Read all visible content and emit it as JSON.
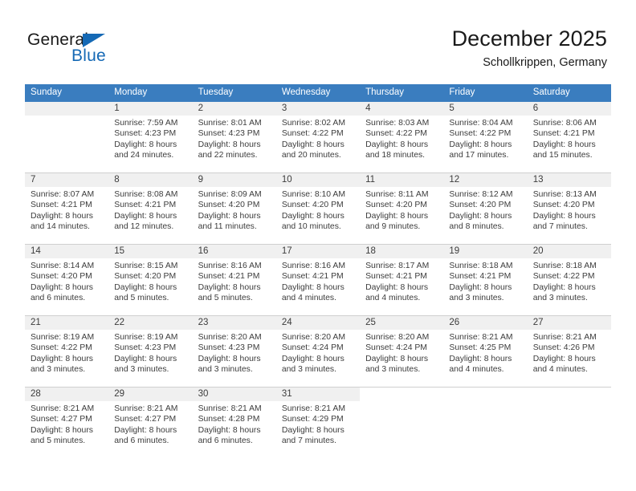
{
  "brand": {
    "name_part1": "General",
    "name_part2": "Blue",
    "triangle_icon": "triangle-icon",
    "color_primary": "#1569b5",
    "color_text": "#1a1a1a"
  },
  "header": {
    "title": "December 2025",
    "subtitle": "Schollkrippen, Germany",
    "header_bg": "#3a7dbf",
    "header_text_color": "#ffffff"
  },
  "weekdays": [
    "Sunday",
    "Monday",
    "Tuesday",
    "Wednesday",
    "Thursday",
    "Friday",
    "Saturday"
  ],
  "weeks": [
    [
      {
        "day": "",
        "empty": true
      },
      {
        "day": "1",
        "sunrise": "Sunrise: 7:59 AM",
        "sunset": "Sunset: 4:23 PM",
        "daylight1": "Daylight: 8 hours",
        "daylight2": "and 24 minutes."
      },
      {
        "day": "2",
        "sunrise": "Sunrise: 8:01 AM",
        "sunset": "Sunset: 4:23 PM",
        "daylight1": "Daylight: 8 hours",
        "daylight2": "and 22 minutes."
      },
      {
        "day": "3",
        "sunrise": "Sunrise: 8:02 AM",
        "sunset": "Sunset: 4:22 PM",
        "daylight1": "Daylight: 8 hours",
        "daylight2": "and 20 minutes."
      },
      {
        "day": "4",
        "sunrise": "Sunrise: 8:03 AM",
        "sunset": "Sunset: 4:22 PM",
        "daylight1": "Daylight: 8 hours",
        "daylight2": "and 18 minutes."
      },
      {
        "day": "5",
        "sunrise": "Sunrise: 8:04 AM",
        "sunset": "Sunset: 4:22 PM",
        "daylight1": "Daylight: 8 hours",
        "daylight2": "and 17 minutes."
      },
      {
        "day": "6",
        "sunrise": "Sunrise: 8:06 AM",
        "sunset": "Sunset: 4:21 PM",
        "daylight1": "Daylight: 8 hours",
        "daylight2": "and 15 minutes."
      }
    ],
    [
      {
        "day": "7",
        "sunrise": "Sunrise: 8:07 AM",
        "sunset": "Sunset: 4:21 PM",
        "daylight1": "Daylight: 8 hours",
        "daylight2": "and 14 minutes."
      },
      {
        "day": "8",
        "sunrise": "Sunrise: 8:08 AM",
        "sunset": "Sunset: 4:21 PM",
        "daylight1": "Daylight: 8 hours",
        "daylight2": "and 12 minutes."
      },
      {
        "day": "9",
        "sunrise": "Sunrise: 8:09 AM",
        "sunset": "Sunset: 4:20 PM",
        "daylight1": "Daylight: 8 hours",
        "daylight2": "and 11 minutes."
      },
      {
        "day": "10",
        "sunrise": "Sunrise: 8:10 AM",
        "sunset": "Sunset: 4:20 PM",
        "daylight1": "Daylight: 8 hours",
        "daylight2": "and 10 minutes."
      },
      {
        "day": "11",
        "sunrise": "Sunrise: 8:11 AM",
        "sunset": "Sunset: 4:20 PM",
        "daylight1": "Daylight: 8 hours",
        "daylight2": "and 9 minutes."
      },
      {
        "day": "12",
        "sunrise": "Sunrise: 8:12 AM",
        "sunset": "Sunset: 4:20 PM",
        "daylight1": "Daylight: 8 hours",
        "daylight2": "and 8 minutes."
      },
      {
        "day": "13",
        "sunrise": "Sunrise: 8:13 AM",
        "sunset": "Sunset: 4:20 PM",
        "daylight1": "Daylight: 8 hours",
        "daylight2": "and 7 minutes."
      }
    ],
    [
      {
        "day": "14",
        "sunrise": "Sunrise: 8:14 AM",
        "sunset": "Sunset: 4:20 PM",
        "daylight1": "Daylight: 8 hours",
        "daylight2": "and 6 minutes."
      },
      {
        "day": "15",
        "sunrise": "Sunrise: 8:15 AM",
        "sunset": "Sunset: 4:20 PM",
        "daylight1": "Daylight: 8 hours",
        "daylight2": "and 5 minutes."
      },
      {
        "day": "16",
        "sunrise": "Sunrise: 8:16 AM",
        "sunset": "Sunset: 4:21 PM",
        "daylight1": "Daylight: 8 hours",
        "daylight2": "and 5 minutes."
      },
      {
        "day": "17",
        "sunrise": "Sunrise: 8:16 AM",
        "sunset": "Sunset: 4:21 PM",
        "daylight1": "Daylight: 8 hours",
        "daylight2": "and 4 minutes."
      },
      {
        "day": "18",
        "sunrise": "Sunrise: 8:17 AM",
        "sunset": "Sunset: 4:21 PM",
        "daylight1": "Daylight: 8 hours",
        "daylight2": "and 4 minutes."
      },
      {
        "day": "19",
        "sunrise": "Sunrise: 8:18 AM",
        "sunset": "Sunset: 4:21 PM",
        "daylight1": "Daylight: 8 hours",
        "daylight2": "and 3 minutes."
      },
      {
        "day": "20",
        "sunrise": "Sunrise: 8:18 AM",
        "sunset": "Sunset: 4:22 PM",
        "daylight1": "Daylight: 8 hours",
        "daylight2": "and 3 minutes."
      }
    ],
    [
      {
        "day": "21",
        "sunrise": "Sunrise: 8:19 AM",
        "sunset": "Sunset: 4:22 PM",
        "daylight1": "Daylight: 8 hours",
        "daylight2": "and 3 minutes."
      },
      {
        "day": "22",
        "sunrise": "Sunrise: 8:19 AM",
        "sunset": "Sunset: 4:23 PM",
        "daylight1": "Daylight: 8 hours",
        "daylight2": "and 3 minutes."
      },
      {
        "day": "23",
        "sunrise": "Sunrise: 8:20 AM",
        "sunset": "Sunset: 4:23 PM",
        "daylight1": "Daylight: 8 hours",
        "daylight2": "and 3 minutes."
      },
      {
        "day": "24",
        "sunrise": "Sunrise: 8:20 AM",
        "sunset": "Sunset: 4:24 PM",
        "daylight1": "Daylight: 8 hours",
        "daylight2": "and 3 minutes."
      },
      {
        "day": "25",
        "sunrise": "Sunrise: 8:20 AM",
        "sunset": "Sunset: 4:24 PM",
        "daylight1": "Daylight: 8 hours",
        "daylight2": "and 3 minutes."
      },
      {
        "day": "26",
        "sunrise": "Sunrise: 8:21 AM",
        "sunset": "Sunset: 4:25 PM",
        "daylight1": "Daylight: 8 hours",
        "daylight2": "and 4 minutes."
      },
      {
        "day": "27",
        "sunrise": "Sunrise: 8:21 AM",
        "sunset": "Sunset: 4:26 PM",
        "daylight1": "Daylight: 8 hours",
        "daylight2": "and 4 minutes."
      }
    ],
    [
      {
        "day": "28",
        "sunrise": "Sunrise: 8:21 AM",
        "sunset": "Sunset: 4:27 PM",
        "daylight1": "Daylight: 8 hours",
        "daylight2": "and 5 minutes."
      },
      {
        "day": "29",
        "sunrise": "Sunrise: 8:21 AM",
        "sunset": "Sunset: 4:27 PM",
        "daylight1": "Daylight: 8 hours",
        "daylight2": "and 6 minutes."
      },
      {
        "day": "30",
        "sunrise": "Sunrise: 8:21 AM",
        "sunset": "Sunset: 4:28 PM",
        "daylight1": "Daylight: 8 hours",
        "daylight2": "and 6 minutes."
      },
      {
        "day": "31",
        "sunrise": "Sunrise: 8:21 AM",
        "sunset": "Sunset: 4:29 PM",
        "daylight1": "Daylight: 8 hours",
        "daylight2": "and 7 minutes."
      },
      {
        "day": "",
        "empty": true,
        "blank": true
      },
      {
        "day": "",
        "empty": true,
        "blank": true
      },
      {
        "day": "",
        "empty": true,
        "blank": true
      }
    ]
  ]
}
